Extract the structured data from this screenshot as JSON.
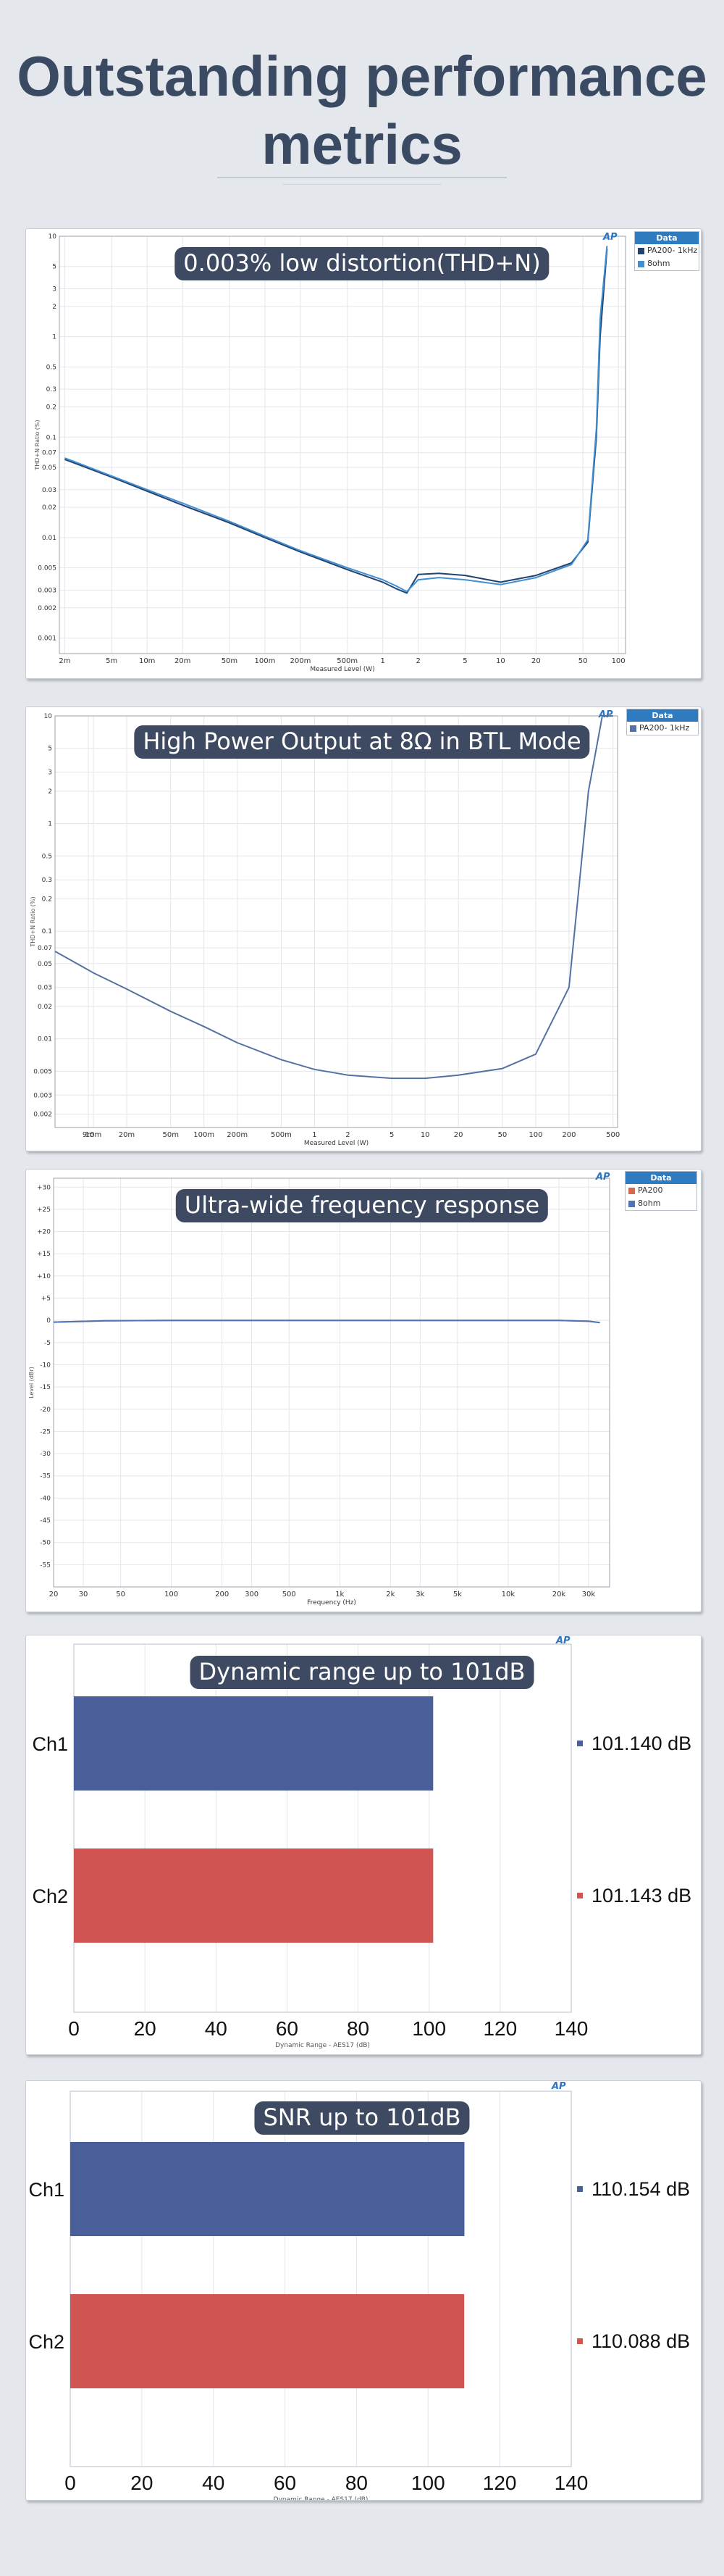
{
  "page": {
    "title_line1": "Outstanding performance",
    "title_line2": "metrics"
  },
  "panels": {
    "thd": {
      "badge": "0.003% low distortion(THD+N)"
    },
    "power": {
      "badge": "High Power Output at 8Ω in BTL Mode"
    },
    "freq": {
      "badge": "Ultra-wide frequency response"
    },
    "dr": {
      "badge": "Dynamic range up to 101dB"
    },
    "snr": {
      "badge": "SNR up to 101dB"
    }
  },
  "logo_text": "AP",
  "chart_data": [
    {
      "type": "line",
      "title": "0.003% low distortion(THD+N)",
      "xlabel": "Measured Level (W)",
      "ylabel": "THD+N Ratio (%)",
      "x_scale": "log",
      "y_scale": "log",
      "xlim": [
        0.0018,
        115
      ],
      "ylim": [
        0.0007,
        10
      ],
      "x_ticks": [
        0.002,
        0.005,
        0.01,
        0.02,
        0.05,
        0.1,
        0.2,
        0.5,
        1,
        2,
        5,
        10,
        20,
        50,
        100
      ],
      "x_tick_labels": [
        "2m",
        "5m",
        "10m",
        "20m",
        "50m",
        "100m",
        "200m",
        "500m",
        "1",
        "2",
        "5",
        "10",
        "20",
        "50",
        "100"
      ],
      "y_ticks": [
        0.001,
        0.002,
        0.003,
        0.005,
        0.01,
        0.02,
        0.03,
        0.05,
        0.07,
        0.1,
        0.2,
        0.3,
        0.5,
        1,
        2,
        3,
        5,
        10
      ],
      "y_tick_labels": [
        "0.001",
        "0.002",
        "0.003",
        "0.005",
        "0.01",
        "0.02",
        "0.03",
        "0.05",
        "0.07",
        "0.1",
        "0.2",
        "0.3",
        "0.5",
        "1",
        "2",
        "3",
        "5",
        "10"
      ],
      "grid": true,
      "legend": {
        "title": "Data",
        "placement": "top-right"
      },
      "series": [
        {
          "name": "PA200- 1kHz",
          "color": "#23426e",
          "x": [
            0.002,
            0.005,
            0.01,
            0.02,
            0.05,
            0.1,
            0.2,
            0.5,
            1,
            1.3,
            1.6,
            2,
            3,
            5,
            10,
            20,
            40,
            55,
            65,
            70,
            80
          ],
          "y": [
            0.06,
            0.04,
            0.029,
            0.021,
            0.014,
            0.01,
            0.0072,
            0.0048,
            0.0036,
            0.0031,
            0.0028,
            0.0043,
            0.0044,
            0.0042,
            0.0036,
            0.0042,
            0.0056,
            0.009,
            0.1,
            1,
            7.5
          ]
        },
        {
          "name": "8ohm",
          "color": "#3f8fd2",
          "x": [
            0.002,
            0.005,
            0.01,
            0.02,
            0.05,
            0.1,
            0.2,
            0.5,
            1,
            1.3,
            1.6,
            2,
            3,
            5,
            10,
            20,
            40,
            55,
            65,
            70,
            80
          ],
          "y": [
            0.062,
            0.041,
            0.03,
            0.022,
            0.0145,
            0.0103,
            0.0074,
            0.005,
            0.0038,
            0.0033,
            0.0029,
            0.0038,
            0.004,
            0.0038,
            0.0034,
            0.004,
            0.0054,
            0.0095,
            0.12,
            1.5,
            8
          ]
        }
      ]
    },
    {
      "type": "line",
      "title": "High Power Output at 8Ω in BTL Mode",
      "xlabel": "Measured Level (W)",
      "ylabel": "THD+N Ratio (%)",
      "x_scale": "log",
      "y_scale": "log",
      "xlim": [
        0.0045,
        550
      ],
      "ylim": [
        0.0015,
        10
      ],
      "x_ticks": [
        0.009,
        0.01,
        0.02,
        0.05,
        0.1,
        0.2,
        0.5,
        1,
        2,
        5,
        10,
        20,
        50,
        100,
        200,
        500
      ],
      "x_tick_labels": [
        "9m",
        "10m",
        "20m",
        "50m",
        "100m",
        "200m",
        "500m",
        "1",
        "2",
        "5",
        "10",
        "20",
        "50",
        "100",
        "200",
        "500"
      ],
      "y_ticks": [
        0.002,
        0.003,
        0.005,
        0.01,
        0.02,
        0.03,
        0.05,
        0.07,
        0.1,
        0.2,
        0.3,
        0.5,
        1,
        2,
        3,
        5,
        10
      ],
      "y_tick_labels": [
        "0.002",
        "0.003",
        "0.005",
        "0.01",
        "0.02",
        "0.03",
        "0.05",
        "0.07",
        "0.1",
        "0.2",
        "0.3",
        "0.5",
        "1",
        "2",
        "3",
        "5",
        "10"
      ],
      "grid": true,
      "legend": {
        "title": "Data",
        "placement": "top-right"
      },
      "series": [
        {
          "name": "PA200- 1kHz",
          "color": "#5570a2",
          "x": [
            0.0045,
            0.01,
            0.02,
            0.05,
            0.1,
            0.2,
            0.5,
            1,
            2,
            5,
            10,
            20,
            50,
            100,
            200,
            250,
            300,
            400,
            500
          ],
          "y": [
            0.065,
            0.041,
            0.029,
            0.018,
            0.013,
            0.0092,
            0.0064,
            0.0052,
            0.0046,
            0.0043,
            0.0043,
            0.0046,
            0.0053,
            0.0072,
            0.03,
            0.3,
            2,
            10,
            10
          ]
        }
      ]
    },
    {
      "type": "line",
      "title": "Ultra-wide frequency response",
      "xlabel": "Frequency (Hz)",
      "ylabel": "Level (dBr)",
      "x_scale": "log",
      "y_scale": "linear",
      "xlim": [
        20,
        40000
      ],
      "ylim": [
        -60,
        32
      ],
      "x_ticks": [
        20,
        30,
        50,
        100,
        200,
        300,
        500,
        1000,
        2000,
        3000,
        5000,
        10000,
        20000,
        30000
      ],
      "x_tick_labels": [
        "20",
        "30",
        "50",
        "100",
        "200",
        "300",
        "500",
        "1k",
        "2k",
        "3k",
        "5k",
        "10k",
        "20k",
        "30k"
      ],
      "y_ticks": [
        30,
        25,
        20,
        15,
        10,
        5,
        0,
        -5,
        -10,
        -15,
        -20,
        -25,
        -30,
        -35,
        -40,
        -45,
        -50,
        -55
      ],
      "y_tick_labels": [
        "+30",
        "+25",
        "+20",
        "+15",
        "+10",
        "+5",
        "0",
        "-5",
        "-10",
        "-15",
        "-20",
        "-25",
        "-30",
        "-35",
        "-40",
        "-45",
        "-50",
        "-55"
      ],
      "grid": true,
      "legend": {
        "title": "Data",
        "placement": "top-right"
      },
      "series": [
        {
          "name": "PA200",
          "color": "#d26a50",
          "x": [
            20,
            40,
            100,
            1000,
            10000,
            20000,
            30000,
            35000
          ],
          "y": [
            -0.4,
            -0.1,
            0,
            0,
            0,
            0,
            -0.2,
            -0.5
          ]
        },
        {
          "name": "8ohm",
          "color": "#4f74b5",
          "x": [
            20,
            40,
            100,
            1000,
            10000,
            20000,
            30000,
            35000
          ],
          "y": [
            -0.4,
            -0.1,
            0,
            0,
            0,
            0,
            -0.2,
            -0.5
          ]
        }
      ]
    },
    {
      "type": "bar",
      "orientation": "horizontal",
      "title": "Dynamic range up to 101dB",
      "xlabel": "Dynamic Range - AES17 (dB)",
      "categories": [
        "Ch1",
        "Ch2"
      ],
      "values": [
        101.14,
        101.143
      ],
      "value_labels": [
        "101.140 dB",
        "101.143 dB"
      ],
      "colors": [
        "#4a5f9a",
        "#d05552"
      ],
      "xlim": [
        0,
        140
      ],
      "x_ticks": [
        0,
        20,
        40,
        60,
        80,
        100,
        120,
        140
      ],
      "x_tick_labels": [
        "0",
        "20",
        "40",
        "60",
        "80",
        "100",
        "120",
        "140"
      ],
      "grid": true
    },
    {
      "type": "bar",
      "orientation": "horizontal",
      "title": "SNR up to 101dB",
      "xlabel": "Dynamic Range - AES17 (dB)",
      "categories": [
        "Ch1",
        "Ch2"
      ],
      "values": [
        110.154,
        110.088
      ],
      "value_labels": [
        "110.154 dB",
        "110.088 dB"
      ],
      "colors": [
        "#4a5f9a",
        "#d05552"
      ],
      "xlim": [
        0,
        140
      ],
      "x_ticks": [
        0,
        20,
        40,
        60,
        80,
        100,
        120,
        140
      ],
      "x_tick_labels": [
        "0",
        "20",
        "40",
        "60",
        "80",
        "100",
        "120",
        "140"
      ],
      "grid": true
    }
  ]
}
